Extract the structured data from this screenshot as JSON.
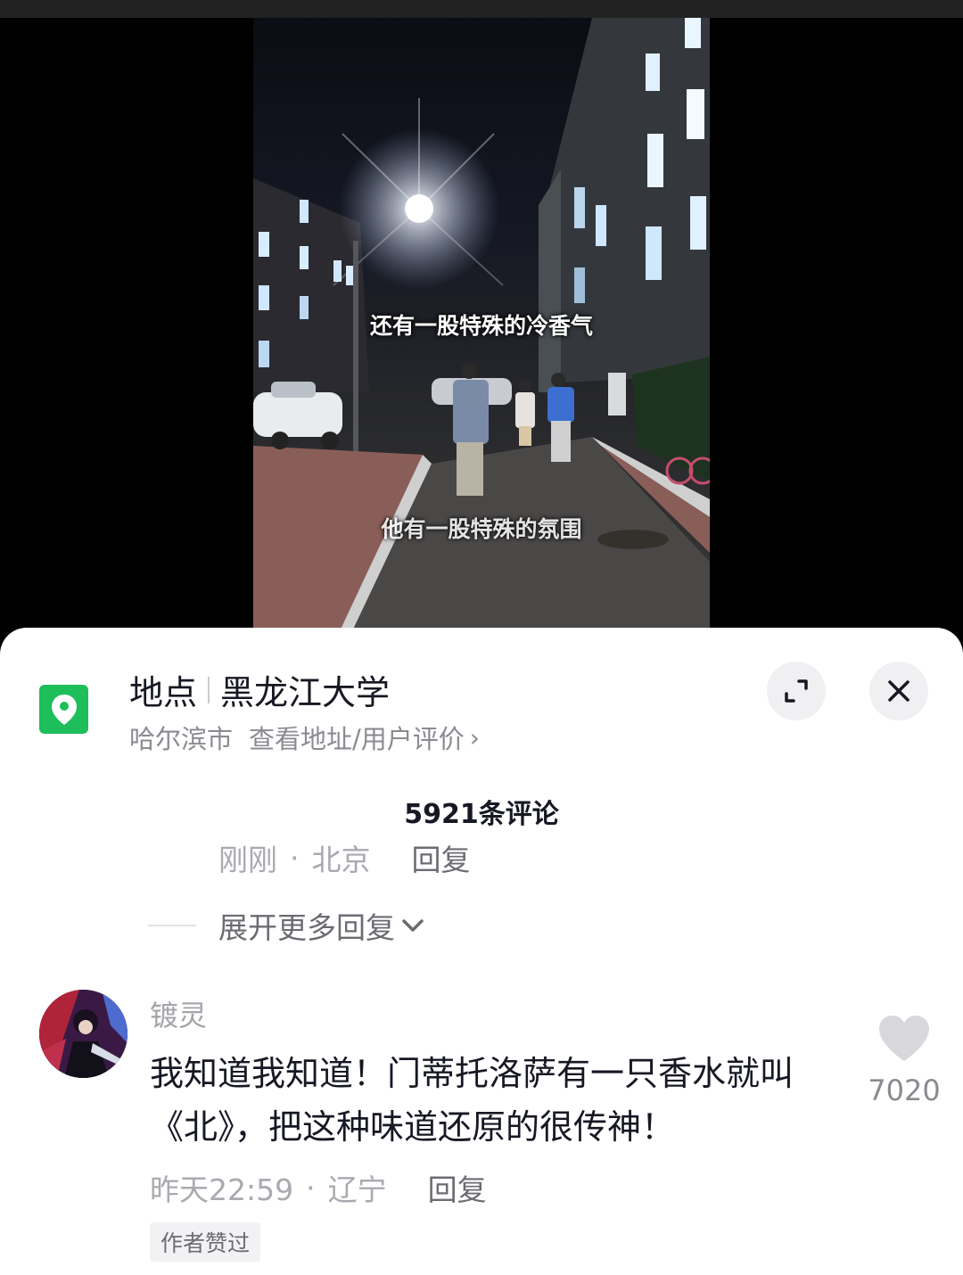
{
  "video": {
    "caption_top": "还有一股特殊的冷香气",
    "caption_bottom": "他有一股特殊的氛围"
  },
  "location": {
    "label": "地点",
    "name": "黑龙江大学",
    "city": "哈尔滨市",
    "link_text": "查看地址/用户评价",
    "icon": "map-pin-icon",
    "icon_color": "#1ebe5a"
  },
  "header_buttons": {
    "expand_icon": "fullscreen-icon",
    "close_icon": "close-icon"
  },
  "comments": {
    "count_label": "5921条评论",
    "previous_reply": {
      "time": "刚刚",
      "region": "北京",
      "reply_label": "回复"
    },
    "expand_more_label": "展开更多回复",
    "items": [
      {
        "username": "镀灵",
        "text": "我知道我知道！门蒂托洛萨有一只香水就叫《北》，把这种味道还原的很传神！",
        "time": "昨天22:59",
        "region": "辽宁",
        "reply_label": "回复",
        "likes": "7020",
        "badge": "作者赞过"
      }
    ]
  }
}
